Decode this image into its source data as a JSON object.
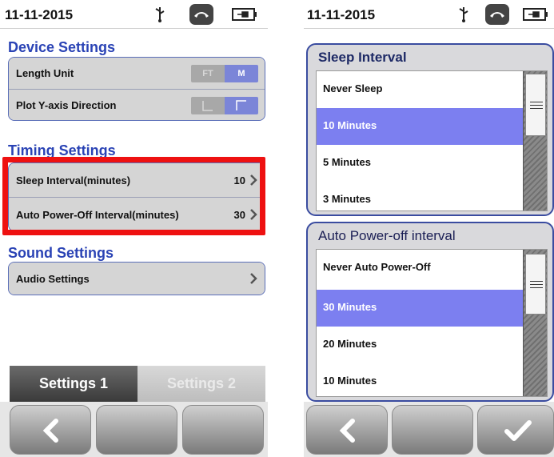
{
  "left": {
    "status": {
      "date": "11-11-2015"
    },
    "device_settings": {
      "title": "Device Settings",
      "length_unit": {
        "label": "Length Unit",
        "opt_off": "FT",
        "opt_on": "M"
      },
      "plot_y": {
        "label": "Plot Y-axis Direction"
      }
    },
    "timing_settings": {
      "title": "Timing Settings",
      "sleep": {
        "label": "Sleep Interval(minutes)",
        "value": "10"
      },
      "autooff": {
        "label": "Auto Power-Off Interval(minutes)",
        "value": "30"
      }
    },
    "sound_settings": {
      "title": "Sound Settings",
      "audio": {
        "label": "Audio Settings"
      }
    },
    "tabs": {
      "tab1": "Settings 1",
      "tab2": "Settings 2"
    }
  },
  "right": {
    "status": {
      "date": "11-11-2015"
    },
    "sleep_panel": {
      "title": "Sleep Interval",
      "options": [
        "Never Sleep",
        "10 Minutes",
        "5 Minutes",
        "3 Minutes"
      ],
      "selected": "10 Minutes"
    },
    "power_panel": {
      "title": "Auto Power-off interval",
      "options": [
        "Never Auto Power-Off",
        "30 Minutes",
        "20 Minutes",
        "10 Minutes"
      ],
      "selected": "30 Minutes"
    }
  },
  "colors": {
    "accent_blue": "#2a43b5",
    "selection": "#7c7ff0",
    "highlight_red": "#ee1111"
  },
  "icons": [
    "usb-icon",
    "phone-icon",
    "battery-icon",
    "chevron-right-icon",
    "back-arrow-icon",
    "checkmark-icon"
  ]
}
